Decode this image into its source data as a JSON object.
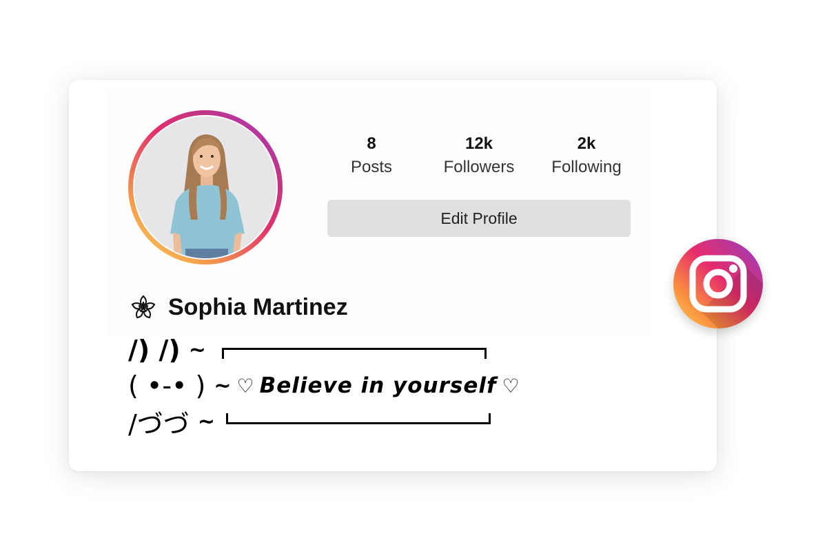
{
  "profile": {
    "name": "Sophia Martinez",
    "stats": [
      {
        "value": "8",
        "label": "Posts"
      },
      {
        "value": "12k",
        "label": "Followers"
      },
      {
        "value": "2k",
        "label": "Following"
      }
    ],
    "edit_button": "Edit Profile"
  },
  "bio": {
    "line1_ears": "/) /)",
    "line2_face": "( •-• )",
    "line3_paws": "/づづ",
    "tilde": "~",
    "heart": "♡",
    "quote": "Believe in yourself"
  },
  "colors": {
    "ring_start": "#f9d463",
    "ring_end": "#a23cc9",
    "button_bg": "#e0e0e0",
    "instagram_gradient": [
      "#fdd35a",
      "#fa8e3e",
      "#e62c6d",
      "#c1358f",
      "#8f3bd2"
    ]
  },
  "icons": {
    "name_prefix": "cherry-blossom-icon",
    "badge": "instagram-logo-icon",
    "avatar": "profile-photo"
  }
}
